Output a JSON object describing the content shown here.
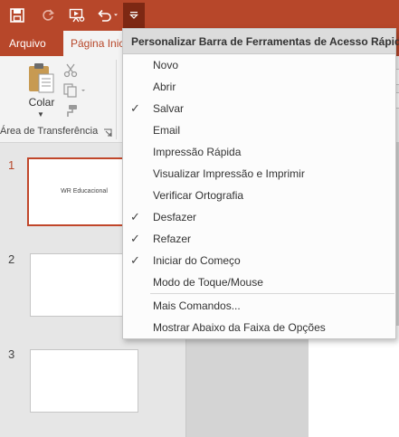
{
  "qat": {
    "icons": [
      "save-icon",
      "repeat-icon",
      "start-from-beginning-icon",
      "undo-icon",
      "customize-dropdown-icon"
    ]
  },
  "tabs": {
    "file": "Arquivo",
    "home": "Página Inicial"
  },
  "ribbon": {
    "paste_label": "Colar",
    "clipboard_group_label": "Área de Transferência"
  },
  "slides": {
    "numbers": [
      "1",
      "2",
      "3"
    ],
    "slide1_text": "WR Educacional"
  },
  "menu": {
    "header": "Personalizar Barra de Ferramentas de Acesso Rápido",
    "items": [
      {
        "label": "Novo",
        "checked": false
      },
      {
        "label": "Abrir",
        "checked": false
      },
      {
        "label": "Salvar",
        "checked": true
      },
      {
        "label": "Email",
        "checked": false
      },
      {
        "label": "Impressão Rápida",
        "checked": false
      },
      {
        "label": "Visualizar Impressão e Imprimir",
        "checked": false
      },
      {
        "label": "Verificar Ortografia",
        "checked": false
      },
      {
        "label": "Desfazer",
        "checked": true
      },
      {
        "label": "Refazer",
        "checked": true
      },
      {
        "label": "Iniciar do Começo",
        "checked": true
      },
      {
        "label": "Modo de Toque/Mouse",
        "checked": false
      }
    ],
    "more_commands": "Mais Comandos...",
    "show_below": "Mostrar Abaixo da Faixa de Opções",
    "check_glyph": "✓"
  },
  "colors": {
    "accent": "#b7472a",
    "accent_dark": "#7d2813"
  }
}
